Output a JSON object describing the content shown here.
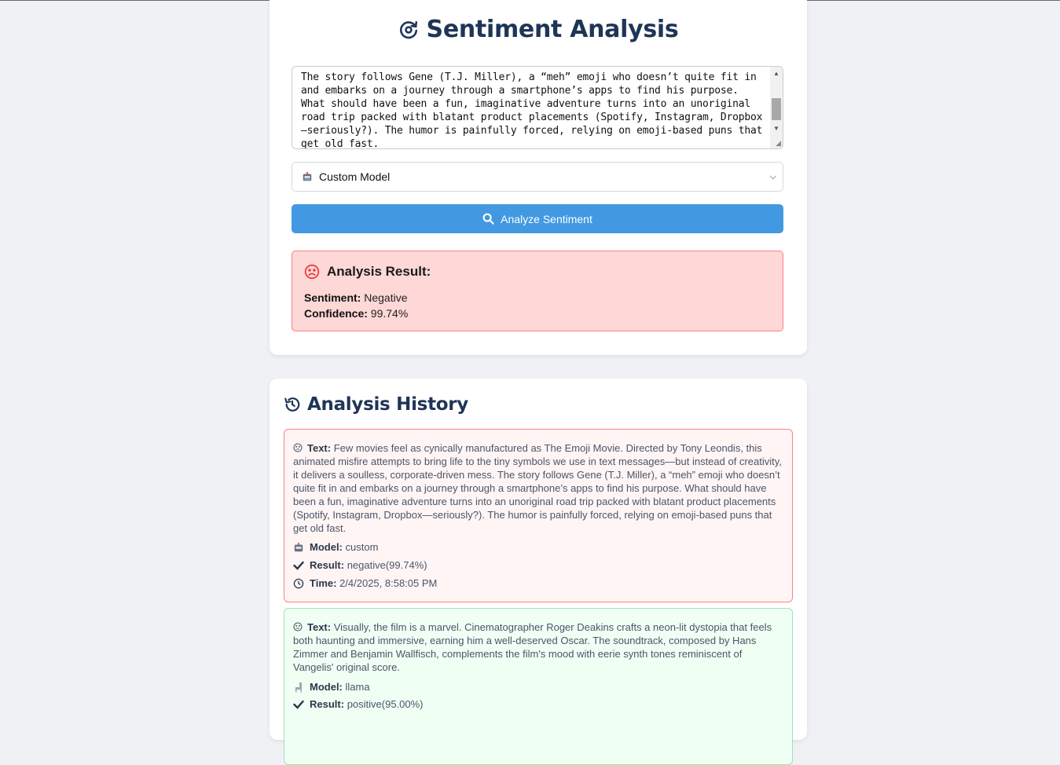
{
  "header": {
    "title": "Sentiment Analysis",
    "icon": "eye-sync-icon"
  },
  "input": {
    "text": "The story follows Gene (T.J. Miller), a “meh” emoji who doesn’t quite fit in and embarks on a journey through a smartphone’s apps to find his purpose. What should have been a fun, imaginative adventure turns into an unoriginal road trip packed with blatant product placements (Spotify, Instagram, Dropbox—seriously?). The humor is painfully forced, relying on emoji-based puns that get old fast."
  },
  "model_select": {
    "selected": "Custom Model",
    "icon": "robot-icon"
  },
  "analyze_button": {
    "label": "Analyze Sentiment",
    "icon": "search-icon"
  },
  "result": {
    "heading": "Analysis Result:",
    "sentiment_label": "Sentiment:",
    "sentiment_value": "Negative",
    "confidence_label": "Confidence:",
    "confidence_value": "99.74%",
    "color": "#fed7d7"
  },
  "history": {
    "heading": "Analysis History",
    "items": [
      {
        "text_label": "Text:",
        "text": "Few movies feel as cynically manufactured as The Emoji Movie. Directed by Tony Leondis, this animated misfire attempts to bring life to the tiny symbols we use in text messages—but instead of creativity, it delivers a soulless, corporate-driven mess. The story follows Gene (T.J. Miller), a “meh” emoji who doesn’t quite fit in and embarks on a journey through a smartphone’s apps to find his purpose. What should have been a fun, imaginative adventure turns into an unoriginal road trip packed with blatant product placements (Spotify, Instagram, Dropbox—seriously?). The humor is painfully forced, relying on emoji-based puns that get old fast.",
        "model_label": "Model:",
        "model": "custom",
        "result_label": "Result:",
        "result": "negative(99.74%)",
        "time_label": "Time:",
        "time": "2/4/2025, 8:58:05 PM"
      },
      {
        "text_label": "Text:",
        "text": "Visually, the film is a marvel. Cinematographer Roger Deakins crafts a neon-lit dystopia that feels both haunting and immersive, earning him a well-deserved Oscar. The soundtrack, composed by Hans Zimmer and Benjamin Wallfisch, complements the film's mood with eerie synth tones reminiscent of Vangelis' original score.",
        "model_label": "Model:",
        "model": "llama",
        "result_label": "Result:",
        "result": "positive(95.00%)"
      }
    ]
  }
}
